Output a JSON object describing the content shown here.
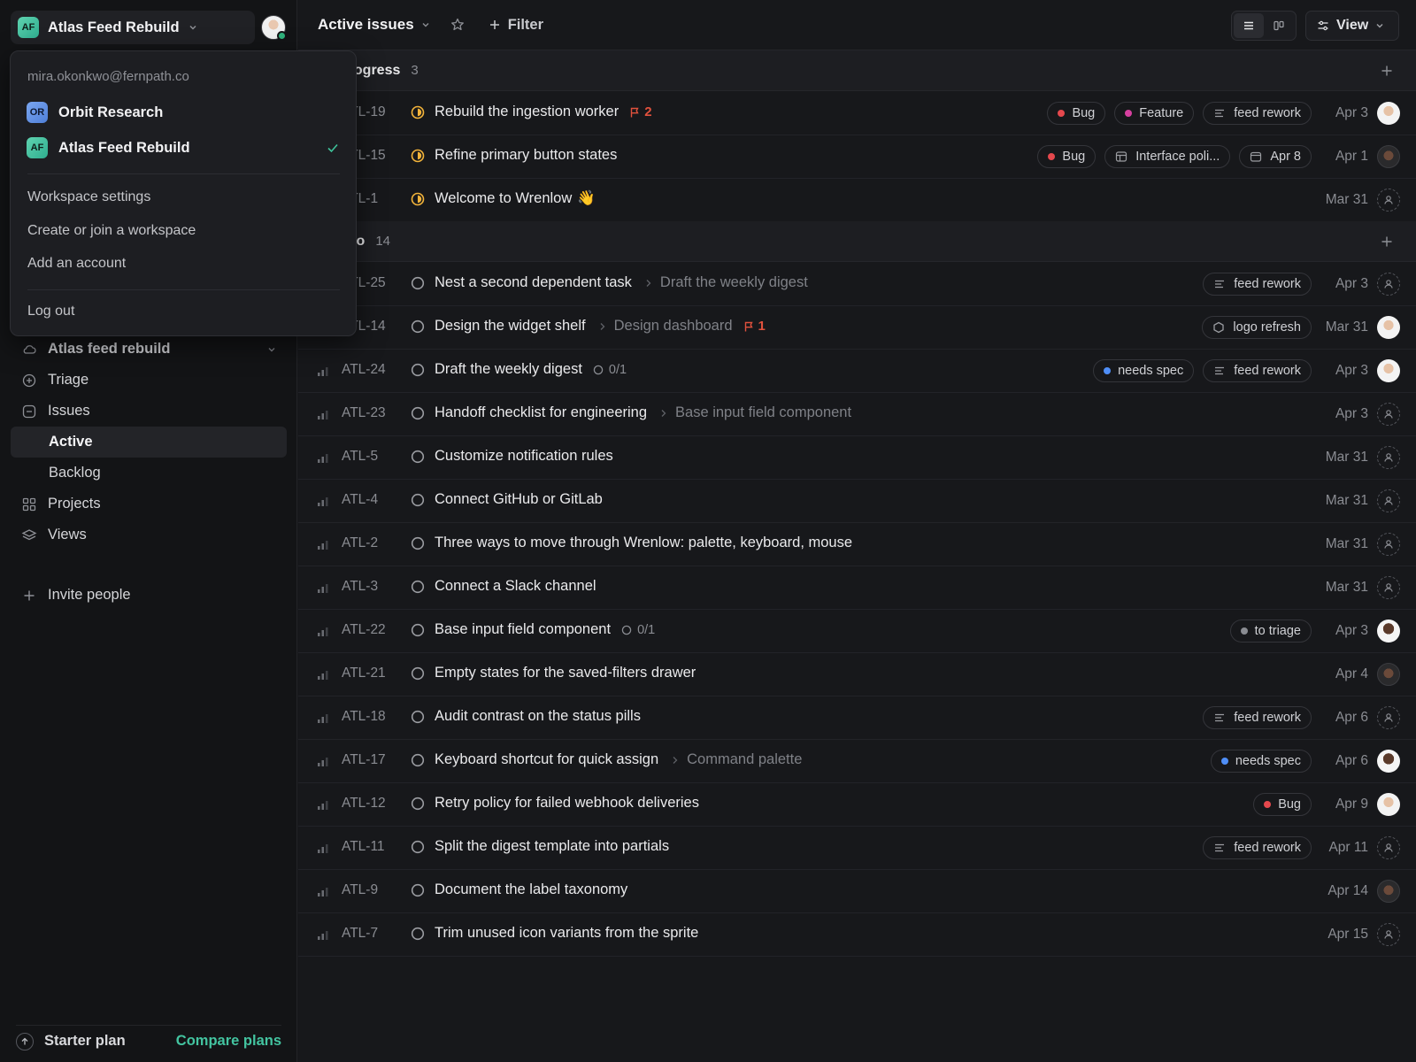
{
  "workspace": {
    "name": "Atlas Feed Rebuild",
    "badge": "AF"
  },
  "dropdown": {
    "email": "mira.okonkwo@fernpath.co",
    "workspaces": [
      {
        "badge": "OR",
        "name": "Orbit Research",
        "selected": false
      },
      {
        "badge": "AF",
        "name": "Atlas Feed Rebuild",
        "selected": true
      }
    ],
    "items": [
      "Workspace settings",
      "Create or join a workspace",
      "Add an account"
    ],
    "logout": "Log out"
  },
  "sidebar": {
    "team": "Atlas feed rebuild",
    "items": [
      {
        "label": "Triage",
        "icon": "triage-icon"
      },
      {
        "label": "Issues",
        "icon": "issues-icon"
      },
      {
        "label": "Active",
        "icon": ""
      },
      {
        "label": "Backlog",
        "icon": ""
      },
      {
        "label": "Projects",
        "icon": "projects-icon"
      },
      {
        "label": "Views",
        "icon": "views-icon"
      }
    ],
    "invite": "Invite people",
    "plan": "Starter plan",
    "compare": "Compare plans"
  },
  "header": {
    "title": "Active issues",
    "filter": "Filter",
    "view": "View"
  },
  "groups": [
    {
      "name": "Progress",
      "count": "3",
      "rows": [
        {
          "id": "ATL-19",
          "status": "in-progress",
          "title": "Rebuild the ingestion worker",
          "flag": "2",
          "labels": [
            {
              "kind": "dot",
              "color": "#e5484d",
              "text": "Bug"
            },
            {
              "kind": "dot",
              "color": "#d6409f",
              "text": "Feature"
            },
            {
              "kind": "project",
              "text": "feed rework"
            }
          ],
          "date": "Apr 3",
          "assignee": "p1"
        },
        {
          "id": "ATL-15",
          "status": "in-progress",
          "title": "Refine primary button states",
          "labels": [
            {
              "kind": "dot",
              "color": "#e5484d",
              "text": "Bug"
            },
            {
              "kind": "cycle",
              "text": "Interface poli..."
            },
            {
              "kind": "calendar",
              "text": "Apr 8"
            }
          ],
          "date": "Apr 1",
          "assignee": "p2"
        },
        {
          "id": "ATL-1",
          "status": "in-progress",
          "title": "Welcome to Wrenlow",
          "emoji": "👋",
          "labels": [],
          "date": "Mar 31",
          "assignee": "none"
        }
      ]
    },
    {
      "name": "odo",
      "count": "14",
      "rows": [
        {
          "id": "ATL-25",
          "status": "todo",
          "title": "Nest a second dependent task",
          "parent": "Draft the weekly digest",
          "labels": [
            {
              "kind": "project",
              "text": "feed rework"
            }
          ],
          "date": "Apr 3",
          "assignee": "none"
        },
        {
          "id": "ATL-14",
          "status": "todo",
          "title": "Design the widget shelf",
          "parent": "Design dashboard",
          "flag": "1",
          "labels": [
            {
              "kind": "hex",
              "text": "logo refresh"
            }
          ],
          "date": "Mar 31",
          "assignee": "p1"
        },
        {
          "id": "ATL-24",
          "status": "todo",
          "title": "Draft the weekly digest",
          "sub": "0/1",
          "labels": [
            {
              "kind": "dot",
              "color": "#4f8ef7",
              "text": "needs spec"
            },
            {
              "kind": "project",
              "text": "feed rework"
            }
          ],
          "date": "Apr 3",
          "assignee": "p1"
        },
        {
          "id": "ATL-23",
          "status": "todo",
          "title": "Handoff checklist for engineering",
          "parent": "Base input field component",
          "labels": [],
          "date": "Apr 3",
          "assignee": "none"
        },
        {
          "id": "ATL-5",
          "status": "todo",
          "title": "Customize notification rules",
          "labels": [],
          "date": "Mar 31",
          "assignee": "none"
        },
        {
          "id": "ATL-4",
          "status": "todo",
          "title": "Connect GitHub or GitLab",
          "labels": [],
          "date": "Mar 31",
          "assignee": "none"
        },
        {
          "id": "ATL-2",
          "status": "todo",
          "title": "Three ways to move through Wrenlow: palette, keyboard, mouse",
          "labels": [],
          "date": "Mar 31",
          "assignee": "none"
        },
        {
          "id": "ATL-3",
          "status": "todo",
          "title": "Connect a Slack channel",
          "labels": [],
          "date": "Mar 31",
          "assignee": "none"
        },
        {
          "id": "ATL-22",
          "status": "todo",
          "title": "Base input field component",
          "sub": "0/1",
          "labels": [
            {
              "kind": "dot",
              "color": "#8a8c92",
              "text": "to triage"
            }
          ],
          "date": "Apr 3",
          "assignee": "p3"
        },
        {
          "id": "ATL-21",
          "status": "todo",
          "title": "Empty states for the saved-filters drawer",
          "labels": [],
          "date": "Apr 4",
          "assignee": "p2"
        },
        {
          "id": "ATL-18",
          "status": "todo",
          "title": "Audit contrast on the status pills",
          "labels": [
            {
              "kind": "project",
              "text": "feed rework"
            }
          ],
          "date": "Apr 6",
          "assignee": "none"
        },
        {
          "id": "ATL-17",
          "status": "todo",
          "title": "Keyboard shortcut for quick assign",
          "parent": "Command palette",
          "labels": [
            {
              "kind": "dot",
              "color": "#4f8ef7",
              "text": "needs spec"
            }
          ],
          "date": "Apr 6",
          "assignee": "p3"
        },
        {
          "id": "ATL-12",
          "status": "todo",
          "title": "Retry policy for failed webhook deliveries",
          "labels": [
            {
              "kind": "dot",
              "color": "#e5484d",
              "text": "Bug"
            }
          ],
          "date": "Apr 9",
          "assignee": "p1"
        },
        {
          "id": "ATL-11",
          "status": "todo",
          "title": "Split the digest template into partials",
          "labels": [
            {
              "kind": "project",
              "text": "feed rework"
            }
          ],
          "date": "Apr 11",
          "assignee": "none"
        },
        {
          "id": "ATL-9",
          "status": "todo",
          "title": "Document the label taxonomy",
          "labels": [],
          "date": "Apr 14",
          "assignee": "p2"
        },
        {
          "id": "ATL-7",
          "status": "todo",
          "title": "Trim unused icon variants from the sprite",
          "labels": [],
          "date": "Apr 15",
          "assignee": "none"
        }
      ]
    }
  ]
}
